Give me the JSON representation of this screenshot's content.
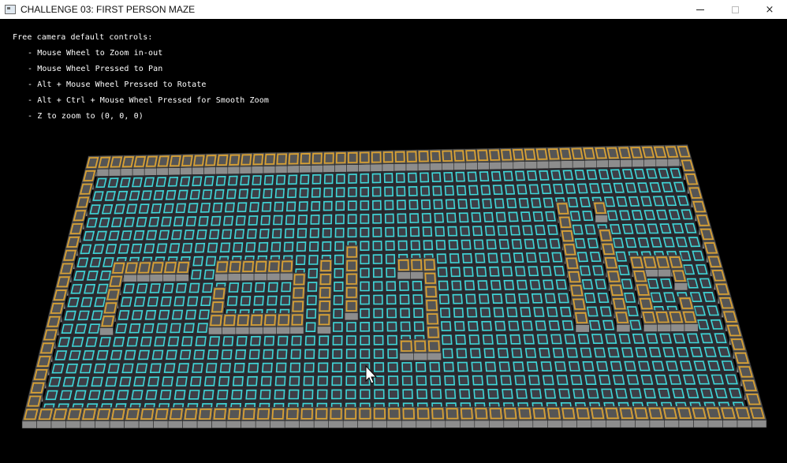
{
  "window": {
    "title": "CHALLENGE 03: FIRST PERSON MAZE",
    "controls": {
      "minimize": "minimize",
      "maximize": "maximize",
      "close": "×"
    }
  },
  "help": {
    "heading": "Free camera default controls:",
    "items": [
      "- Mouse Wheel to Zoom in-out",
      "- Mouse Wheel Pressed to Pan",
      "- Alt + Mouse Wheel Pressed to Rotate",
      "- Alt + Ctrl + Mouse Wheel Pressed for Smooth Zoom",
      "- Z to zoom to (0, 0, 0)"
    ]
  },
  "colors": {
    "background": "#000000",
    "wall_top": "#555555",
    "wall_frame": "#d8a033",
    "floor_top": "#3e3e46",
    "floor_frame": "#3fd7d9",
    "wall_side": "#8d8d8d"
  },
  "maze": {
    "rows": [
      "111111111111111111111111111111111111111111111111111",
      "100000000000000000000000000000000000000000000000001",
      "100000000000000000000000000000000000000000000000001",
      "100000000000000000000000000000000000000000000000001",
      "100000000000000000000000000000000000000100100000001",
      "100000000000000000000000000000000000000100000000001",
      "100000000000000000000000000000000000000100100000001",
      "100000000000000000000010000000000000000100100000001",
      "100011111100111111001010001110000000000100101111001",
      "100010000000000000101010000010000000000100101001001",
      "100010000000100000101010000010000000000100101000001",
      "100010000000100000101010000010000000000100101001001",
      "100010000000111111101000000010000000000100101111001",
      "100000000000000000000000000010000000000000000000001",
      "100000000000000000000000001110000000000000000000001",
      "100000000000000000000000000000000000000000000000001",
      "100000000000000000000000000000000000000000000000001",
      "100000000000000000000000000000000000000000000000001",
      "100000000000000000000000000000000000000000000000001",
      "111111111111111111111111111111111111111111111111111"
    ]
  },
  "cursor": {
    "name": "mouse-pointer"
  }
}
